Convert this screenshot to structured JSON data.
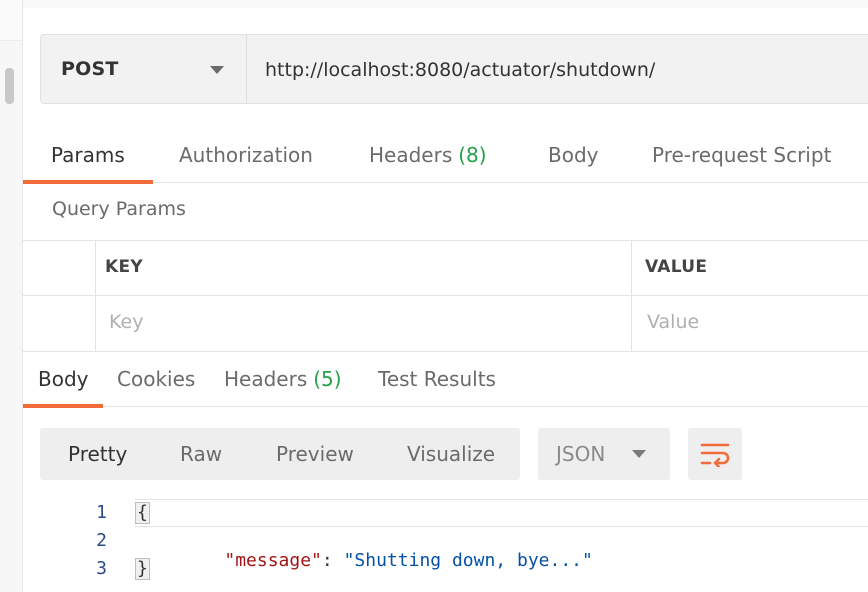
{
  "request": {
    "method": "POST",
    "url": "http://localhost:8080/actuator/shutdown/"
  },
  "request_tabs": [
    {
      "label": "Params",
      "count": ""
    },
    {
      "label": "Authorization",
      "count": ""
    },
    {
      "label": "Headers",
      "count": "(8)"
    },
    {
      "label": "Body",
      "count": ""
    },
    {
      "label": "Pre-request Script",
      "count": ""
    }
  ],
  "query_params": {
    "title": "Query Params",
    "columns": [
      "KEY",
      "VALUE"
    ],
    "key_placeholder": "Key",
    "value_placeholder": "Value"
  },
  "response_tabs": [
    {
      "label": "Body",
      "count": ""
    },
    {
      "label": "Cookies",
      "count": ""
    },
    {
      "label": "Headers",
      "count": "(5)"
    },
    {
      "label": "Test Results",
      "count": ""
    }
  ],
  "view_modes": [
    "Pretty",
    "Raw",
    "Preview",
    "Visualize"
  ],
  "format": "JSON",
  "code": {
    "line_numbers": [
      "1",
      "2",
      "3"
    ],
    "open_brace": "{",
    "close_brace": "}",
    "key": "\"message\"",
    "colon": ": ",
    "value": "\"Shutting down, bye...\""
  },
  "colors": {
    "accent": "#f26b3a",
    "count_green": "#26a04b",
    "json_key": "#a31515",
    "json_string": "#0451a5"
  },
  "icons": {
    "method_dropdown": "chevron-down-icon",
    "format_dropdown": "chevron-down-icon",
    "wrap": "wrap-lines-icon"
  }
}
